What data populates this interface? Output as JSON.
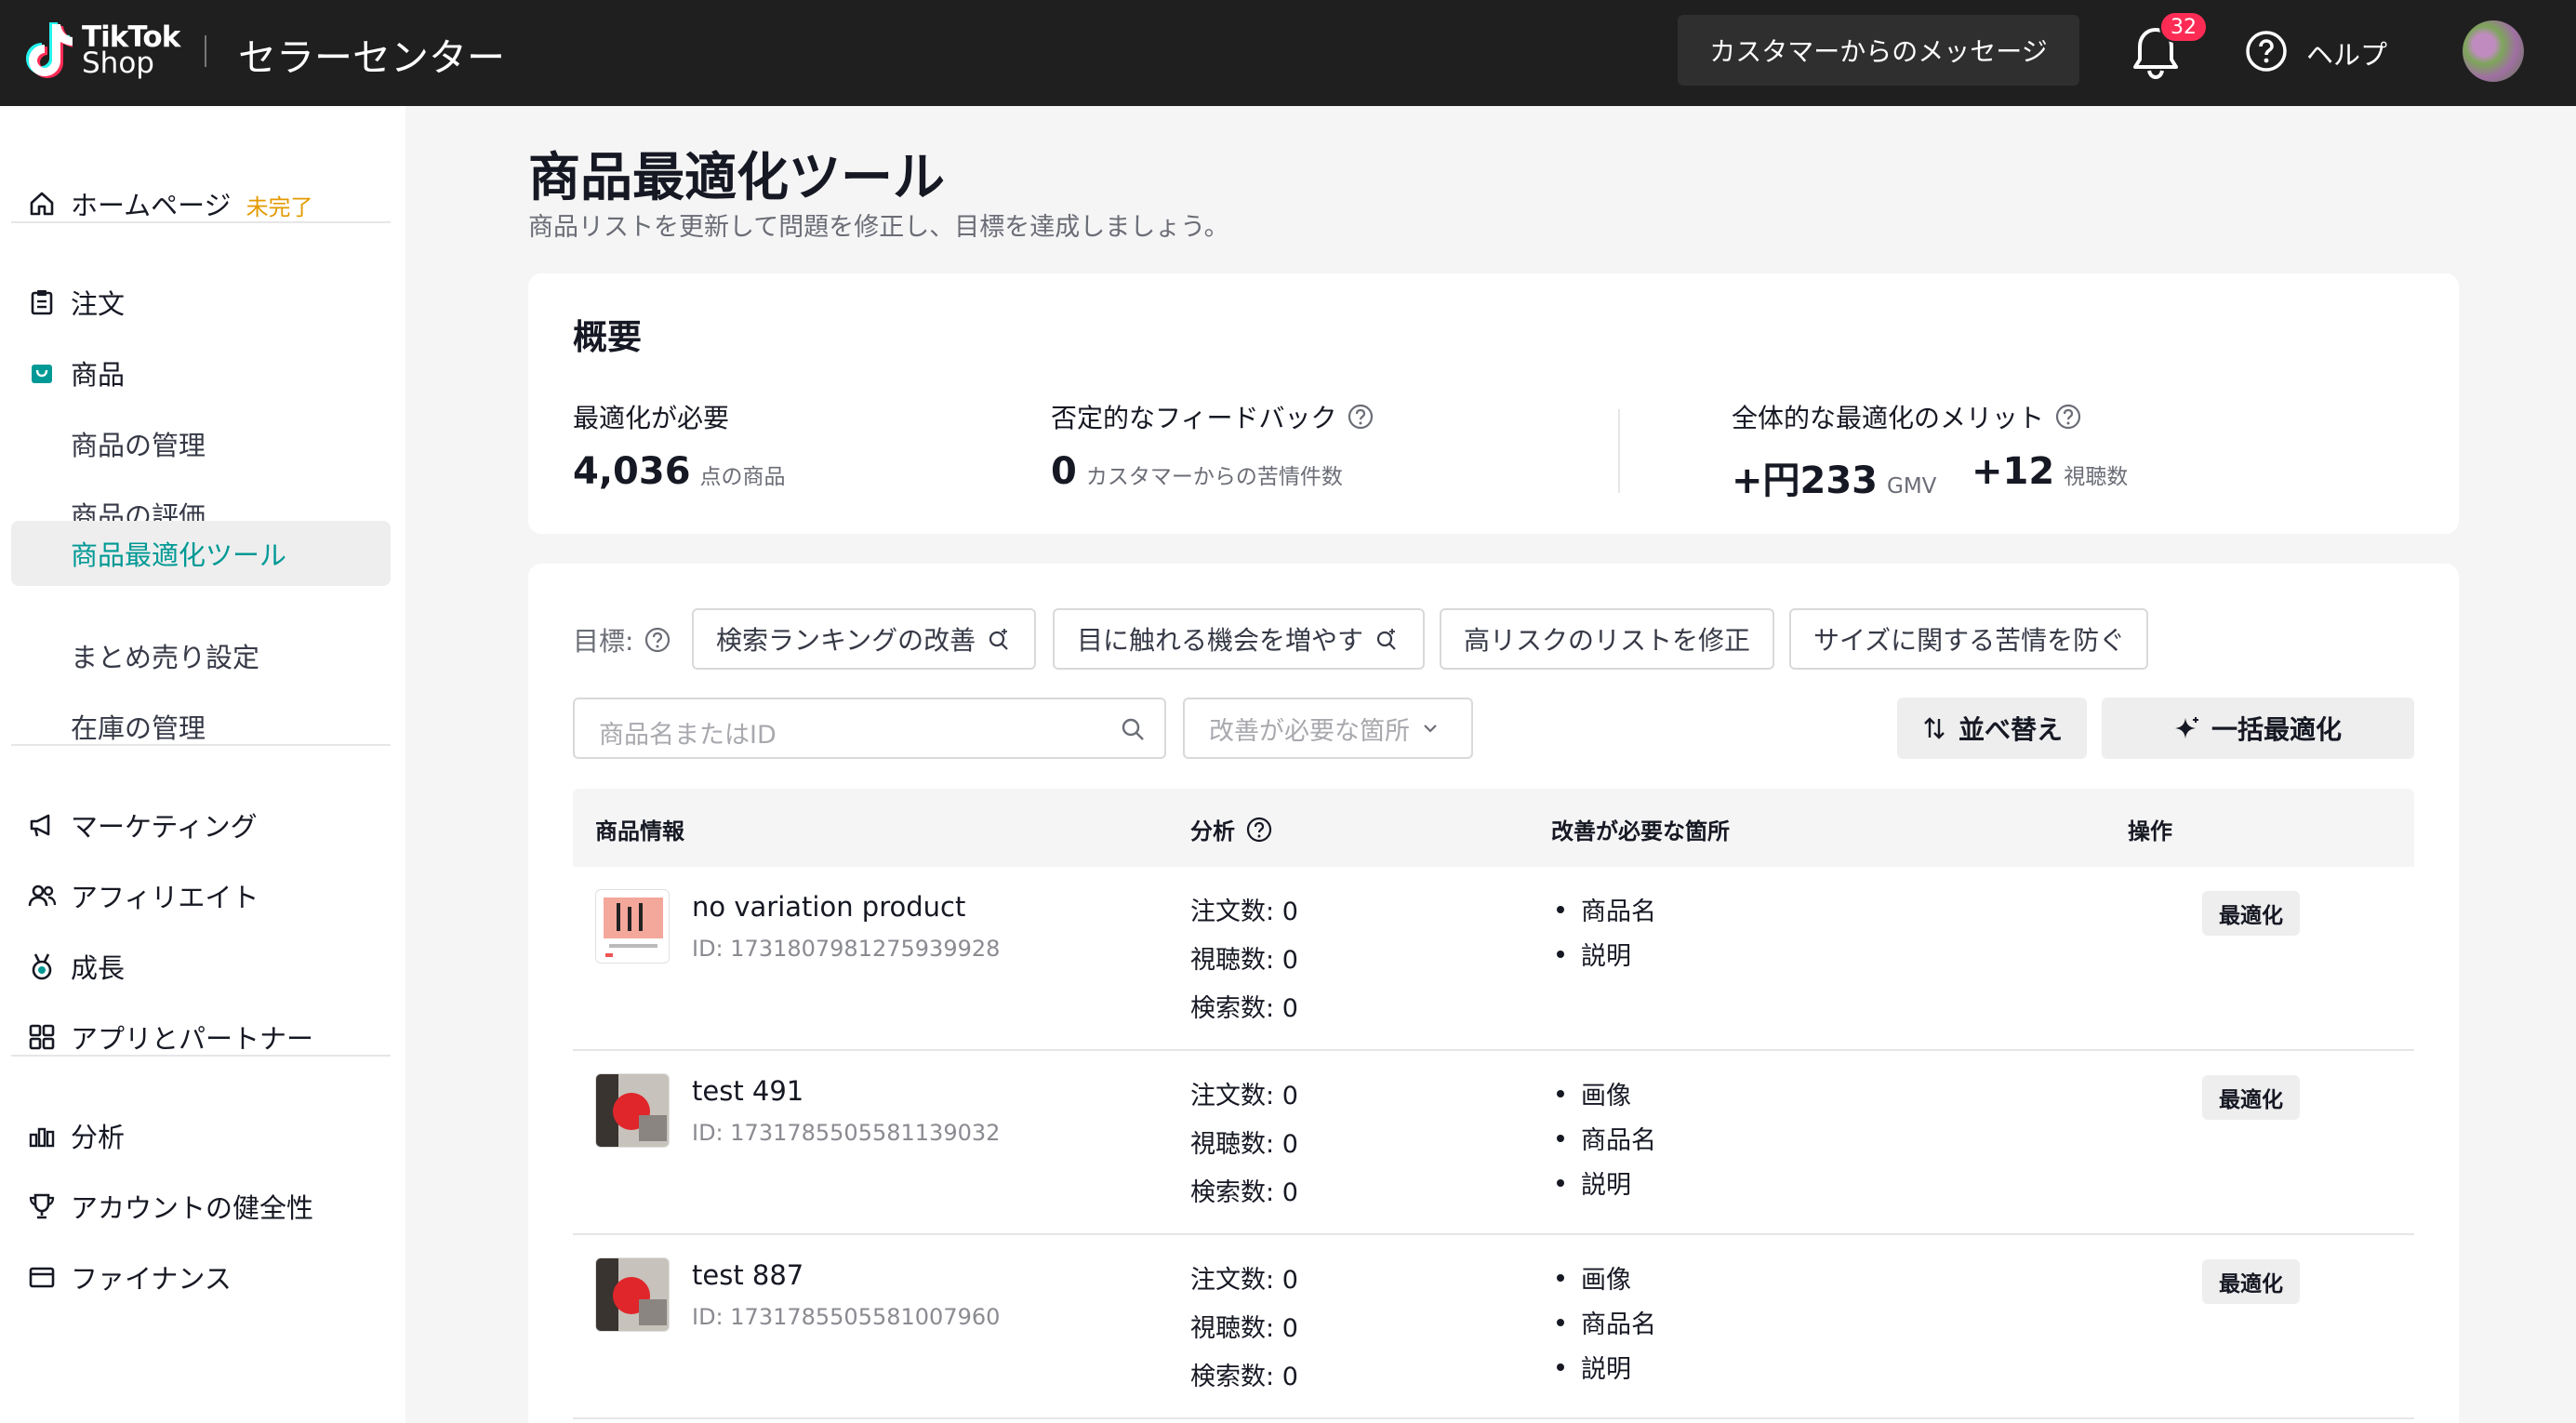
{
  "header": {
    "logo_line1": "TikTok",
    "logo_line2": "Shop",
    "title": "セラーセンター",
    "messages_button": "カスタマーからのメッセージ",
    "notification_count": "32",
    "help_label": "ヘルプ"
  },
  "sidebar": {
    "home": {
      "label": "ホームページ",
      "status": "未完了"
    },
    "items": [
      {
        "label": "注文",
        "icon": "clipboard-icon"
      },
      {
        "label": "商品",
        "icon": "shopping-bag-icon"
      },
      {
        "label": "商品の管理"
      },
      {
        "label": "商品の評価"
      },
      {
        "label": "商品最適化ツール"
      },
      {
        "label": "まとめ売り設定"
      },
      {
        "label": "在庫の管理"
      },
      {
        "label": "マーケティング",
        "icon": "megaphone-icon"
      },
      {
        "label": "アフィリエイト",
        "icon": "people-icon"
      },
      {
        "label": "成長",
        "icon": "medal-icon"
      },
      {
        "label": "アプリとパートナー",
        "icon": "apps-icon"
      },
      {
        "label": "分析",
        "icon": "chart-icon"
      },
      {
        "label": "アカウントの健全性",
        "icon": "trophy-icon"
      },
      {
        "label": "ファイナンス",
        "icon": "wallet-icon"
      }
    ]
  },
  "page": {
    "title": "商品最適化ツール",
    "subtitle": "商品リストを更新して問題を修正し、目標を達成しましょう。"
  },
  "overview": {
    "title": "概要",
    "needs_optimization": {
      "label": "最適化が必要",
      "value": "4,036",
      "unit": "点の商品"
    },
    "negative_feedback": {
      "label": "否定的なフィードバック",
      "value": "0",
      "unit": "カスタマーからの苦情件数"
    },
    "overall_benefit": {
      "label": "全体的な最適化のメリット",
      "gmv_value": "+円233",
      "gmv_unit": "GMV",
      "views_value": "+12",
      "views_unit": "視聴数"
    }
  },
  "goals": {
    "label": "目標:",
    "chips": [
      "検索ランキングの改善",
      "目に触れる機会を増やす",
      "高リスクのリストを修正",
      "サイズに関する苦情を防ぐ"
    ]
  },
  "filters": {
    "search_placeholder": "商品名またはID",
    "issue_dropdown": "改善が必要な箇所",
    "sort_button": "並べ替え",
    "bulk_button": "一括最適化"
  },
  "table": {
    "headers": [
      "商品情報",
      "分析",
      "改善が必要な箇所",
      "操作"
    ],
    "stat_labels": [
      "注文数: ",
      "視聴数: ",
      "検索数: "
    ],
    "action_label": "最適化",
    "rows": [
      {
        "name": "no variation product",
        "id": "ID: 1731807981275939928",
        "orders": "0",
        "views": "0",
        "searches": "0",
        "issues": [
          "商品名",
          "説明"
        ]
      },
      {
        "name": "test 491",
        "id": "ID: 1731785505581139032",
        "orders": "0",
        "views": "0",
        "searches": "0",
        "issues": [
          "画像",
          "商品名",
          "説明"
        ]
      },
      {
        "name": "test 887",
        "id": "ID: 1731785505581007960",
        "orders": "0",
        "views": "0",
        "searches": "0",
        "issues": [
          "画像",
          "商品名",
          "説明"
        ]
      }
    ]
  },
  "colors": {
    "accent": "#009995",
    "topbar": "#1f1f1f",
    "badge": "#fe2c55",
    "pending": "#e49a00"
  }
}
